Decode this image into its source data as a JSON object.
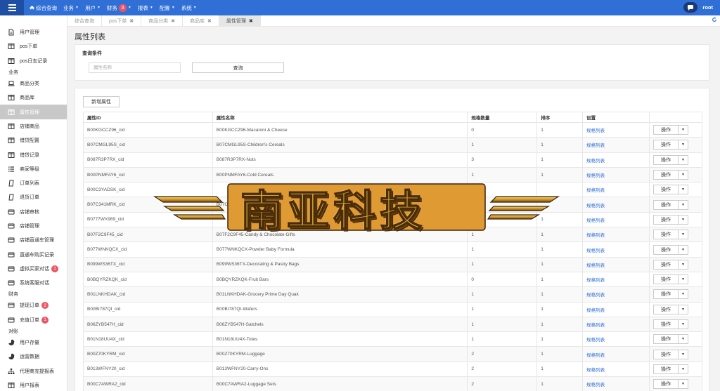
{
  "topnav": {
    "items": [
      {
        "label": "综合查询",
        "has_caret": false,
        "badge": ""
      },
      {
        "label": "业务",
        "has_caret": true,
        "badge": ""
      },
      {
        "label": "用户",
        "has_caret": true,
        "badge": ""
      },
      {
        "label": "财务",
        "has_caret": true,
        "badge": "3"
      },
      {
        "label": "报表",
        "has_caret": true,
        "badge": ""
      },
      {
        "label": "配置",
        "has_caret": true,
        "badge": ""
      },
      {
        "label": "系统",
        "has_caret": true,
        "badge": ""
      }
    ],
    "user": "root"
  },
  "sidebar": [
    {
      "type": "item",
      "label": "用户管理",
      "icon": "file-icon"
    },
    {
      "type": "item",
      "label": "pos下单",
      "icon": "columns-icon"
    },
    {
      "type": "item",
      "label": "pos日志记录",
      "icon": "columns-icon"
    },
    {
      "type": "cat",
      "label": "业务"
    },
    {
      "type": "item",
      "label": "商品分类",
      "icon": "laptop-icon"
    },
    {
      "type": "item",
      "label": "商品库",
      "icon": "columns-icon"
    },
    {
      "type": "item",
      "label": "属性管理",
      "icon": "columns-icon",
      "active": true
    },
    {
      "type": "item",
      "label": "店铺商品",
      "icon": "columns-icon"
    },
    {
      "type": "item",
      "label": "借贷配置",
      "icon": "columns-icon"
    },
    {
      "type": "item",
      "label": "借贷记录",
      "icon": "columns-icon"
    },
    {
      "type": "item",
      "label": "卖家等级",
      "icon": "list-icon"
    },
    {
      "type": "item",
      "label": "订单列表",
      "icon": "clipboard-icon"
    },
    {
      "type": "item",
      "label": "退货订单",
      "icon": "clipboard-icon"
    },
    {
      "type": "item",
      "label": "店铺审核",
      "icon": "card-icon"
    },
    {
      "type": "item",
      "label": "店铺管理",
      "icon": "card-icon"
    },
    {
      "type": "item",
      "label": "店铺直通车管理",
      "icon": "card-icon"
    },
    {
      "type": "item",
      "label": "直通车购买记录",
      "icon": "card-icon"
    },
    {
      "type": "item",
      "label": "虚拟买家对话",
      "icon": "card-icon",
      "badge": "1"
    },
    {
      "type": "item",
      "label": "系统客服对话",
      "icon": "card-icon"
    },
    {
      "type": "cat",
      "label": "财务"
    },
    {
      "type": "item",
      "label": "提现订单",
      "icon": "card-icon",
      "badge": "2"
    },
    {
      "type": "item",
      "label": "充值订单",
      "icon": "card-icon",
      "badge": "1"
    },
    {
      "type": "cat",
      "label": "对账"
    },
    {
      "type": "item",
      "label": "用户存量",
      "icon": "pie-icon"
    },
    {
      "type": "item",
      "label": "运营数据",
      "icon": "pie-icon"
    },
    {
      "type": "item",
      "label": "代理商充提报表",
      "icon": "sitemap-icon"
    },
    {
      "type": "item",
      "label": "用户报表",
      "icon": "columns-icon"
    }
  ],
  "tabs": [
    {
      "label": "综合查询",
      "closable": false,
      "active": false
    },
    {
      "label": "pos下单",
      "closable": true,
      "active": false
    },
    {
      "label": "商品分类",
      "closable": true,
      "active": false
    },
    {
      "label": "商品库",
      "closable": true,
      "active": false
    },
    {
      "label": "属性管理",
      "closable": true,
      "active": true
    }
  ],
  "page": {
    "title": "属性列表",
    "query_label": "查询条件",
    "search_placeholder": "属性名称",
    "search_value": "",
    "search_button": "查询",
    "add_button": "新增属性"
  },
  "table": {
    "headers": [
      "属性ID",
      "属性名称",
      "规格数量",
      "排序",
      "设置",
      ""
    ],
    "link_label": "规格列表",
    "op_label": "操作",
    "rows": [
      [
        "B00KGCCZ96_cid",
        "B00KGCCZ96-Macaroni & Cheese",
        "0",
        "1"
      ],
      [
        "B07CMGL95S_cid",
        "B07CMGL95S-Children's Cereals",
        "1",
        "1"
      ],
      [
        "B087R3P7RX_cid",
        "B087R3P7RX-Nuts",
        "3",
        "1"
      ],
      [
        "B00PNMFAY6_cid",
        "B00PNMFAY6-Cold Cereals",
        "1",
        "1"
      ],
      [
        "B00C3YADSK_cid",
        "",
        "",
        ""
      ],
      [
        "B07C341MRK_cid",
        "B07C34",
        "",
        ""
      ],
      [
        "B0777WX969_cid",
        "",
        "",
        "1"
      ],
      [
        "B07F2C9F45_cid",
        "B07F2C9F45-Candy & Chocolate Gifts",
        "1",
        "1"
      ],
      [
        "B077WNKQCX_cid",
        "B077WNKQCX-Powder Baby Formula",
        "1",
        "1"
      ],
      [
        "B099WS36TX_cid",
        "B099WS36TX-Decorating & Pastry Bags",
        "1",
        "1"
      ],
      [
        "B0BQYRZKQK_cid",
        "B0BQYRZKQK-Fruit Bars",
        "0",
        "1"
      ],
      [
        "B01LNKHDAK_cid",
        "B01LNKHDAK-Grocery Prime Day Quak",
        "1",
        "1"
      ],
      [
        "B00BI787QI_cid",
        "B00BI787QI-Wafers",
        "1",
        "1"
      ],
      [
        "B06ZYB547H_cid",
        "B06ZYB547H-Satchels",
        "1",
        "1"
      ],
      [
        "B01N18UU4X_cid",
        "B01N18UU4X-Totes",
        "1",
        "1"
      ],
      [
        "B00Z70KYRM_cid",
        "B00Z70KYRM-Luggage",
        "2",
        "1"
      ],
      [
        "B013WFNY20_cid",
        "B013WFNY20-Carry-Ons",
        "2",
        "1"
      ],
      [
        "B00C7AWRA2_cid",
        "B00C7AWRA2-Luggage Sets",
        "2",
        "1"
      ]
    ]
  },
  "watermark": {
    "text": "南亚科技"
  }
}
